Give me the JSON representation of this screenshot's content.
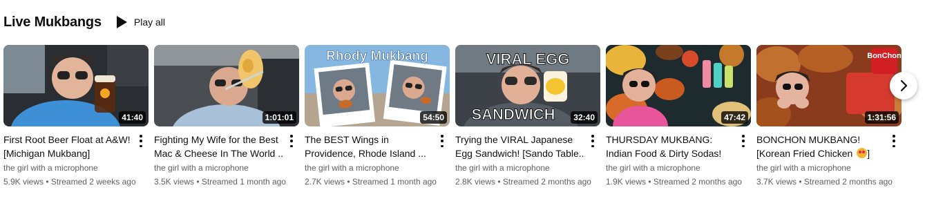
{
  "shelf": {
    "title": "Live Mukbangs",
    "play_all_label": "Play all"
  },
  "videos": [
    {
      "title_line1": "First Root Beer Float at A&W!",
      "title_line2": "[Michigan Mukbang]",
      "duration": "41:40",
      "channel": "the girl with a microphone",
      "stats": "5.9K views • Streamed 2 weeks ago"
    },
    {
      "title_line1": "Fighting My Wife for the Best",
      "title_line2": "Mac & Cheese In The World ...",
      "duration": "1:01:01",
      "channel": "the girl with a microphone",
      "stats": "3.5K views • Streamed 1 month ago"
    },
    {
      "title_line1": "The BEST Wings in",
      "title_line2": "Providence, Rhode Island ...",
      "duration": "54:50",
      "thumb_text": "Rhody Mukbang",
      "channel": "the girl with a microphone",
      "stats": "2.7K views • Streamed 1 month ago"
    },
    {
      "title_line1": "Trying the VIRAL Japanese",
      "title_line2": "Egg Sandwich! [Sando Table...",
      "duration": "32:40",
      "thumb_text_top": "VIRAL EGG",
      "thumb_text_bottom": "SANDWICH",
      "channel": "the girl with a microphone",
      "stats": "2.8K views • Streamed 2 months ago"
    },
    {
      "title_line1": "THURSDAY MUKBANG:",
      "title_line2": "Indian Food & Dirty Sodas!",
      "duration": "47:42",
      "channel": "the girl with a microphone",
      "stats": "1.9K views • Streamed 2 months ago"
    },
    {
      "title_line1": "BONCHON MUKBANG!",
      "title_line2": "[Korean Fried Chicken",
      "duration": "1:31:56",
      "thumb_logo": "BonChon",
      "channel": "the girl with a microphone",
      "stats": "3.7K views • Streamed 2 months ago"
    }
  ],
  "icons": {
    "play": "play-icon",
    "more": "more-vert-icon",
    "next": "chevron-right-icon",
    "emoji": "star-struck-emoji-icon"
  }
}
